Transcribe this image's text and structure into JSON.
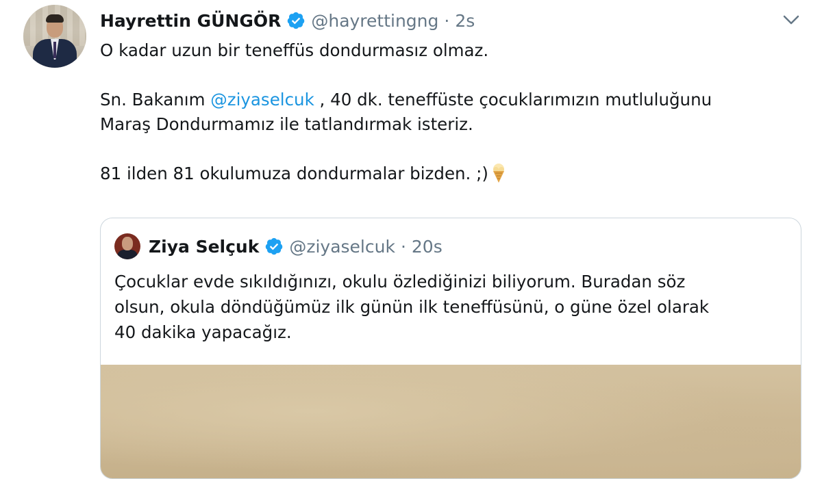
{
  "tweet": {
    "author": {
      "display_name": "Hayrettin GÜNGÖR",
      "handle": "@hayrettingng",
      "separator": "·",
      "time": "2s"
    },
    "text": {
      "line1": "O kadar uzun bir teneffüs dondurmasız olmaz.",
      "line2_pre": "Sn. Bakanım ",
      "line2_mention": "@ziyaselcuk",
      "line2_post": " , 40 dk. teneffüste çocuklarımızın mutluluğunu",
      "line3": "Maraş Dondurmamız ile tatlandırmak isteriz.",
      "line4": "81 ilden 81 okulumuza dondurmalar bizden. ;)"
    },
    "icons": {
      "verified": "verified-badge-icon",
      "menu": "chevron-down-icon",
      "emoji": "ice-cream-emoji-icon"
    }
  },
  "quoted_tweet": {
    "author": {
      "display_name": "Ziya Selçuk",
      "handle": "@ziyaselcuk",
      "separator": "·",
      "time": "20s"
    },
    "text": {
      "line1": "Çocuklar evde sıkıldığınızı, okulu özlediğinizi biliyorum. Buradan söz",
      "line2": "olsun, okula döndüğümüz ilk günün ilk teneffüsünü, o güne özel olarak",
      "line3": "40 dakika yapacağız."
    }
  },
  "colors": {
    "accent": "#1b95e0",
    "secondary_text": "#657786",
    "border": "#ccd6dd"
  }
}
